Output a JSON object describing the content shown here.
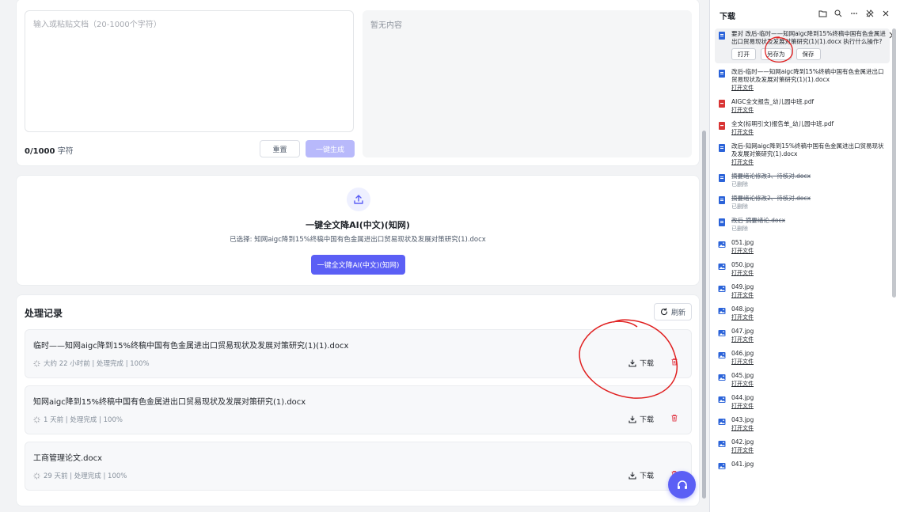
{
  "editor": {
    "input_placeholder": "输入或粘贴文档（20-1000个字符）",
    "output_placeholder": "暂无内容",
    "count_value": "0/1000",
    "count_unit": "字符",
    "reset_label": "重置",
    "generate_label": "一键生成"
  },
  "upload": {
    "title": "一键全文降AI(中文)(知网)",
    "selected": "已选择: 知网aigc降到15%终稿中国有色金属进出口贸易现状及发展对策研究(1).docx",
    "button_label": "一键全文降AI(中文)(知网)"
  },
  "records": {
    "title": "处理记录",
    "refresh_label": "刷新",
    "download_label": "下载",
    "items": [
      {
        "name": "临时——知网aigc降到15%终稿中国有色金属进出口贸易现状及发展对策研究(1)(1).docx",
        "meta": "大约 22 小时前 | 处理完成 | 100%"
      },
      {
        "name": "知网aigc降到15%终稿中国有色金属进出口贸易现状及发展对策研究(1).docx",
        "meta": "1 天前 | 处理完成 | 100%"
      },
      {
        "name": "工商管理论文.docx",
        "meta": "29 天前 | 处理完成 | 100%"
      }
    ]
  },
  "downloads": {
    "title": "下载",
    "first": {
      "prompt": "要对 改后-临时——知网aigc降到15%终稿中国有色金属进出口贸易现状及发展对策研究(1)(1).docx 执行什么操作?",
      "open_label": "打开",
      "save_as_label": "另存为",
      "save_label": "保存"
    },
    "items": [
      {
        "name": "改后-临时——知网aigc降到15%终稿中国有色金属进出口贸易现状及发展对策研究(1)(1).docx",
        "status": "打开文件",
        "type": "doc",
        "deleted": false
      },
      {
        "name": "AIGC全文报告_幼儿园中班.pdf",
        "status": "打开文件",
        "type": "pdf",
        "deleted": false
      },
      {
        "name": "全文(标明引文)报告单_幼儿园中班.pdf",
        "status": "打开文件",
        "type": "pdf",
        "deleted": false
      },
      {
        "name": "改后-知网aigc降到15%终稿中国有色金属进出口贸易现状及发展对策研究(1).docx",
        "status": "打开文件",
        "type": "doc",
        "deleted": false
      },
      {
        "name": "摘要绪论修改3、待核对.docx",
        "status": "已删除",
        "type": "doc",
        "deleted": true
      },
      {
        "name": "摘要绪论修改2、待核对.docx",
        "status": "已删除",
        "type": "doc",
        "deleted": true
      },
      {
        "name": "改后-摘要绪论.docx",
        "status": "已删除",
        "type": "doc",
        "deleted": true
      },
      {
        "name": "051.jpg",
        "status": "打开文件",
        "type": "img",
        "deleted": false
      },
      {
        "name": "050.jpg",
        "status": "打开文件",
        "type": "img",
        "deleted": false
      },
      {
        "name": "049.jpg",
        "status": "打开文件",
        "type": "img",
        "deleted": false
      },
      {
        "name": "048.jpg",
        "status": "打开文件",
        "type": "img",
        "deleted": false
      },
      {
        "name": "047.jpg",
        "status": "打开文件",
        "type": "img",
        "deleted": false
      },
      {
        "name": "046.jpg",
        "status": "打开文件",
        "type": "img",
        "deleted": false
      },
      {
        "name": "045.jpg",
        "status": "打开文件",
        "type": "img",
        "deleted": false
      },
      {
        "name": "044.jpg",
        "status": "打开文件",
        "type": "img",
        "deleted": false
      },
      {
        "name": "043.jpg",
        "status": "打开文件",
        "type": "img",
        "deleted": false
      },
      {
        "name": "042.jpg",
        "status": "打开文件",
        "type": "img",
        "deleted": false
      },
      {
        "name": "041.jpg",
        "status": "",
        "type": "img",
        "deleted": false
      }
    ]
  },
  "colors": {
    "accent": "#5b5ff5",
    "accent_disabled": "#b8b9fb",
    "annotation": "#e02020"
  }
}
